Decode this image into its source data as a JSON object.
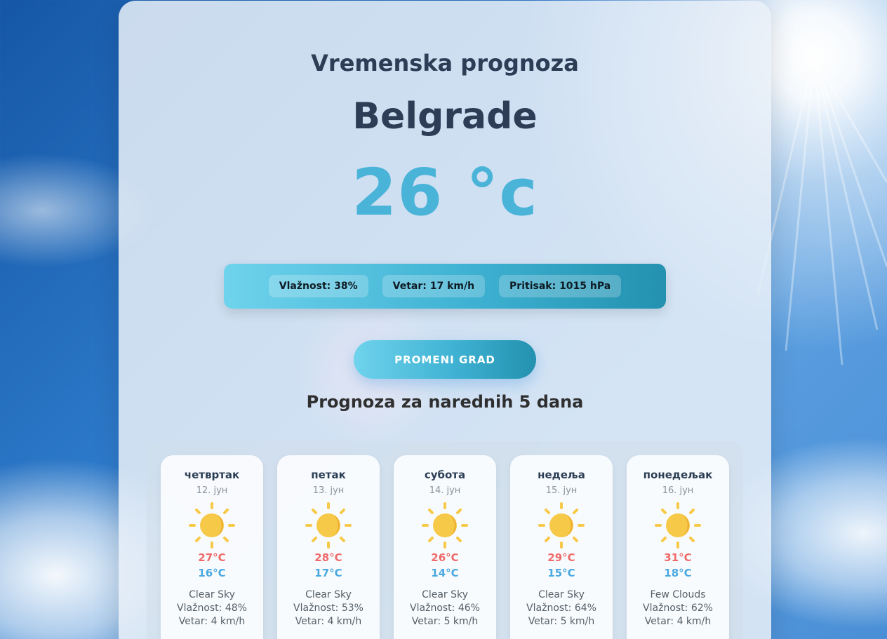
{
  "header": {
    "subtitle": "Vremenska prognoza",
    "city": "Belgrade",
    "temperature": "26 °c"
  },
  "stats": {
    "humidity": "Vlažnost: 38%",
    "wind": "Vetar: 17 km/h",
    "pressure": "Pritisak: 1015 hPa"
  },
  "actions": {
    "change_city_label": "PROMENI GRAD"
  },
  "forecast": {
    "title": "Prognoza za narednih 5 dana",
    "days": [
      {
        "day": "четвртак",
        "date": "12. јун",
        "icon": "sun-icon",
        "max": "27°C",
        "min": "16°C",
        "description": "Clear Sky",
        "humidity": "Vlažnost: 48%",
        "wind": "Vetar: 4 km/h"
      },
      {
        "day": "петак",
        "date": "13. јун",
        "icon": "sun-icon",
        "max": "28°C",
        "min": "17°C",
        "description": "Clear Sky",
        "humidity": "Vlažnost: 53%",
        "wind": "Vetar: 4 km/h"
      },
      {
        "day": "субота",
        "date": "14. јун",
        "icon": "sun-icon",
        "max": "26°C",
        "min": "14°C",
        "description": "Clear Sky",
        "humidity": "Vlažnost: 46%",
        "wind": "Vetar: 5 km/h"
      },
      {
        "day": "недеља",
        "date": "15. јун",
        "icon": "sun-icon",
        "max": "29°C",
        "min": "15°C",
        "description": "Clear Sky",
        "humidity": "Vlažnost: 64%",
        "wind": "Vetar: 5 km/h"
      },
      {
        "day": "понедељак",
        "date": "16. јун",
        "icon": "sun-icon",
        "max": "31°C",
        "min": "18°C",
        "description": "Few Clouds",
        "humidity": "Vlažnost: 62%",
        "wind": "Vetar: 4 km/h"
      }
    ]
  },
  "colors": {
    "accent": "#4ab3d8",
    "title_text": "#2c3e55",
    "max_temp": "#ef6a6a",
    "min_temp": "#4aa8e0",
    "sun": "#f7c948"
  }
}
